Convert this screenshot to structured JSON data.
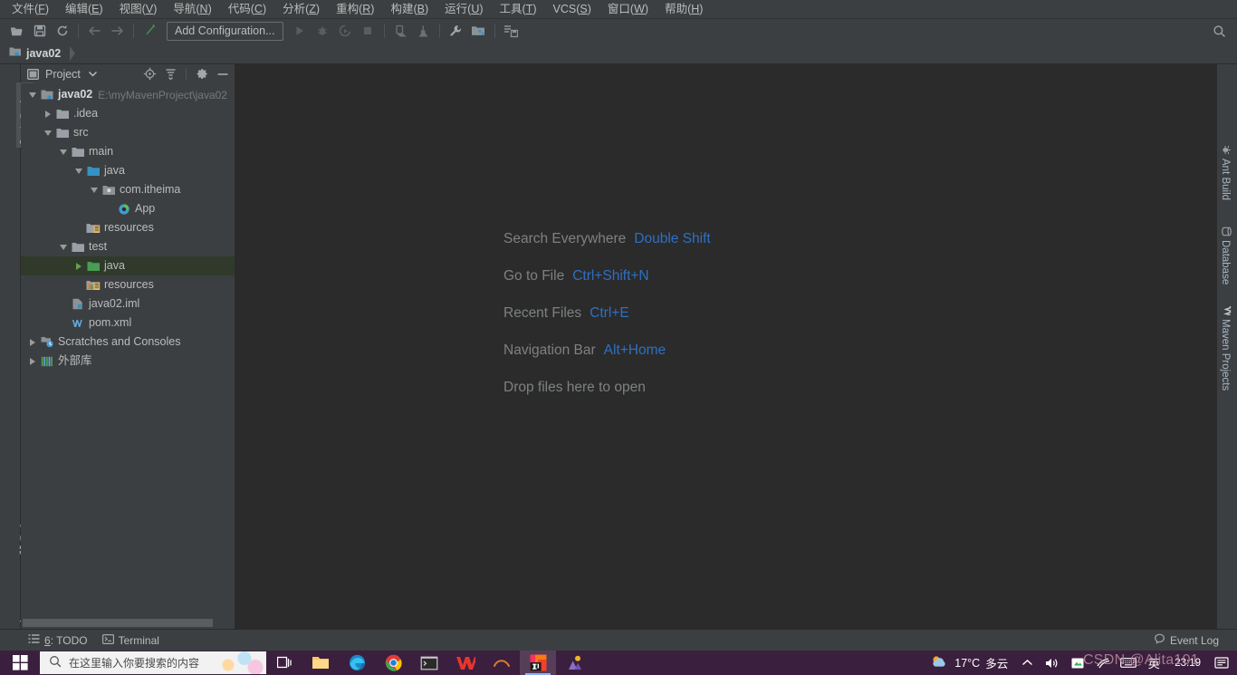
{
  "menu": {
    "items": [
      {
        "label": "文件(F)",
        "mnemonic": "F"
      },
      {
        "label": "编辑(E)",
        "mnemonic": "E"
      },
      {
        "label": "视图(V)",
        "mnemonic": "V"
      },
      {
        "label": "导航(N)",
        "mnemonic": "N"
      },
      {
        "label": "代码(C)",
        "mnemonic": "C"
      },
      {
        "label": "分析(Z)",
        "mnemonic": "Z"
      },
      {
        "label": "重构(R)",
        "mnemonic": "R"
      },
      {
        "label": "构建(B)",
        "mnemonic": "B"
      },
      {
        "label": "运行(U)",
        "mnemonic": "U"
      },
      {
        "label": "工具(T)",
        "mnemonic": "T"
      },
      {
        "label": "VCS(S)",
        "mnemonic": "S"
      },
      {
        "label": "窗口(W)",
        "mnemonic": "W"
      },
      {
        "label": "帮助(H)",
        "mnemonic": "H"
      }
    ]
  },
  "toolbar": {
    "open_label": "open-folder",
    "save_label": "save-all",
    "sync_label": "sync",
    "back_label": "back",
    "forward_label": "forward",
    "edit_label": "edit",
    "run_config": "Add Configuration...",
    "run_label": "run",
    "debug_label": "debug",
    "coverage_label": "run-with-coverage",
    "stop_label": "stop",
    "updateapp_label": "update-application",
    "profile_label": "profiler",
    "settings_label": "settings",
    "structure_label": "project-structure",
    "sync_project_label": "sync-maven",
    "search_label": "search"
  },
  "navbar": {
    "project_name": "java02"
  },
  "left_stripe": {
    "tabs": [
      {
        "label": "1: Project",
        "mnemonic": "1",
        "active": true
      },
      {
        "label": "7: Structure",
        "mnemonic": "7",
        "active": false
      },
      {
        "label": "2: Favorites",
        "mnemonic": "2",
        "active": false
      }
    ]
  },
  "right_stripe": {
    "tabs": [
      {
        "label": "Ant Build"
      },
      {
        "label": "Database"
      },
      {
        "label": "Maven Projects"
      }
    ]
  },
  "project_panel": {
    "title": "Project",
    "locate_label": "locate-in-tree",
    "collapse_label": "collapse-all",
    "settings_label": "panel-settings",
    "hide_label": "hide-panel",
    "tree": [
      {
        "label": "java02",
        "path": "E:\\myMavenProject\\java02",
        "indent": 0,
        "twisty": "down",
        "icon": "module",
        "bold": true,
        "selected": false
      },
      {
        "label": ".idea",
        "path": "",
        "indent": 1,
        "twisty": "right",
        "icon": "folder-gray",
        "bold": false,
        "selected": false
      },
      {
        "label": "src",
        "path": "",
        "indent": 1,
        "twisty": "down",
        "icon": "folder-gray",
        "bold": false,
        "selected": false
      },
      {
        "label": "main",
        "path": "",
        "indent": 2,
        "twisty": "down",
        "icon": "folder-gray",
        "bold": false,
        "selected": false
      },
      {
        "label": "java",
        "path": "",
        "indent": 3,
        "twisty": "down",
        "icon": "folder-blue",
        "bold": false,
        "selected": false
      },
      {
        "label": "com.itheima",
        "path": "",
        "indent": 4,
        "twisty": "down",
        "icon": "package",
        "bold": false,
        "selected": false
      },
      {
        "label": "App",
        "path": "",
        "indent": 5,
        "twisty": "none",
        "icon": "java-class",
        "bold": false,
        "selected": false
      },
      {
        "label": "resources",
        "path": "",
        "indent": 3,
        "twisty": "none",
        "icon": "resources-main",
        "bold": false,
        "selected": false
      },
      {
        "label": "test",
        "path": "",
        "indent": 2,
        "twisty": "down",
        "icon": "folder-gray",
        "bold": false,
        "selected": false
      },
      {
        "label": "java",
        "path": "",
        "indent": 3,
        "twisty": "right-green",
        "icon": "folder-green",
        "bold": false,
        "selected": true
      },
      {
        "label": "resources",
        "path": "",
        "indent": 3,
        "twisty": "none",
        "icon": "resources-test",
        "bold": false,
        "selected": false
      },
      {
        "label": "java02.iml",
        "path": "",
        "indent": 2,
        "twisty": "none",
        "icon": "iml",
        "bold": false,
        "selected": false
      },
      {
        "label": "pom.xml",
        "path": "",
        "indent": 2,
        "twisty": "none",
        "icon": "maven",
        "bold": false,
        "selected": false
      },
      {
        "label": "Scratches and Consoles",
        "path": "",
        "indent": 0,
        "twisty": "right",
        "icon": "scratches",
        "bold": false,
        "selected": false
      },
      {
        "label": "外部库",
        "path": "",
        "indent": 0,
        "twisty": "right",
        "icon": "libraries",
        "bold": false,
        "selected": false
      }
    ]
  },
  "editor": {
    "hints": [
      {
        "name": "Search Everywhere",
        "key": "Double Shift"
      },
      {
        "name": "Go to File",
        "key": "Ctrl+Shift+N"
      },
      {
        "name": "Recent Files",
        "key": "Ctrl+E"
      },
      {
        "name": "Navigation Bar",
        "key": "Alt+Home"
      },
      {
        "name": "Drop files here to open",
        "key": ""
      }
    ]
  },
  "status_bar": {
    "todo_label": "6: TODO",
    "todo_mnemonic": "6",
    "terminal_label": "Terminal",
    "event_log_label": "Event Log"
  },
  "taskbar": {
    "start_label": "start-button",
    "search_placeholder": "在这里输入你要搜索的内容",
    "apps": [
      {
        "name": "task-view-icon"
      },
      {
        "name": "file-explorer-icon"
      },
      {
        "name": "edge-icon"
      },
      {
        "name": "chrome-icon"
      },
      {
        "name": "cmd-icon"
      },
      {
        "name": "wps-icon"
      },
      {
        "name": "app-icon"
      },
      {
        "name": "intellij-idea-icon",
        "active": true
      },
      {
        "name": "people-icon"
      }
    ],
    "weather_temp": "17°C",
    "weather_desc": "多云",
    "ime_label": "英",
    "clock_time": "23:19",
    "watermark": "CSDN @Alita101"
  },
  "colors": {
    "bg_chrome": "#3c3f41",
    "bg_editor": "#2b2b2b",
    "accent_link": "#2f6fc4",
    "selection_green": "#2f3a2b",
    "folder_blue": "#3592c4",
    "folder_green": "#499c54",
    "taskbar": "#3b1f3e"
  }
}
